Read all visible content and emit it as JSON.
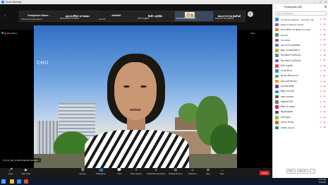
{
  "window": {
    "title": "Zoom Meeting"
  },
  "strip": {
    "tiles": [
      {
        "name": "Pornpimon Kaew...",
        "label": "Pornpimon Kaewsuwan"
      },
      {
        "name": "ผศ.ดร.ศิริพร ทรายทอง",
        "label": "ผศ.ดร.ศิริพร ทรายทอง"
      },
      {
        "name": "AdminK",
        "label": "adminK"
      },
      {
        "name": "ชิงช้า ครูนิจิต",
        "label": "ชิงช้า ครูนิจิต"
      },
      {
        "name": "",
        "label": "ก็มนาฟิลล์ โรงเรียนวัด..."
      },
      {
        "name": "คณะมาธารด สุขสันต์",
        "label": "คณะมาธารด สุขสันต์"
      }
    ]
  },
  "recording_label": "Recording...",
  "view_label": "View",
  "speaker": {
    "name_tag": "07-2_S6_S_S3 Pornpimon Songpo...",
    "backdrop_text": "CHU"
  },
  "toolbar": {
    "buttons": [
      {
        "icon": "microphone-icon",
        "glyph": "🎤",
        "label": "Audio"
      },
      {
        "icon": "video-icon",
        "glyph": "▶",
        "label": "Start Video"
      },
      {
        "icon": "security-icon",
        "glyph": "🛡",
        "label": "Security"
      },
      {
        "icon": "participants-icon",
        "glyph": "👥",
        "label": "Participants"
      },
      {
        "icon": "chat-icon",
        "glyph": "💬",
        "label": "Chat"
      },
      {
        "icon": "share-screen-icon",
        "glyph": "⬆",
        "label": "Share Screen"
      },
      {
        "icon": "record-icon",
        "glyph": "⏸",
        "label": "Pause/Stop Recording"
      },
      {
        "icon": "breakout-icon",
        "glyph": "⊞",
        "label": "Breakout Rooms"
      },
      {
        "icon": "reactions-icon",
        "glyph": "☺",
        "label": "Reactions"
      },
      {
        "icon": "apps-icon",
        "glyph": "⊕",
        "label": "Apps"
      },
      {
        "icon": "more-icon",
        "glyph": "…",
        "label": "More"
      }
    ],
    "leave_label": "Leave"
  },
  "panel": {
    "title": "Participants (38)",
    "search_placeholder": "Find a participant",
    "participants": [
      {
        "name": "Pornpimon Kaewsu... (Co-host, me)",
        "color": "#2d8cff"
      },
      {
        "name": "Sittiporn Siripoom (Host)",
        "color": "#7b5cd6"
      },
      {
        "name": "ผศ.ดร.ศิริพร ทรายทอง (Co-host)",
        "color": "#e27a2b"
      },
      {
        "name": "AdminK",
        "color": "#2aa876"
      },
      {
        "name": "Pornnittha",
        "color": "#c94b7e"
      },
      {
        "name": "คณะมาธารด สุขสันต์",
        "color": "#5a78d6"
      },
      {
        "name": "นิตยา ร่องทองไพศาล",
        "color": "#d6a22a"
      },
      {
        "name": "ก็มนาฟิลล์ โรงเรียนวัด",
        "color": "#3ba0a8"
      },
      {
        "name": "ก็มนาฟิลล์ โรงเรียนวัด",
        "color": "#8a5ad6"
      },
      {
        "name": "ชิงช้า ครูนิจิต",
        "color": "#e0524a"
      },
      {
        "name": "ประวิต ดีงาม",
        "color": "#2d8cff"
      },
      {
        "name": "สุดาพร เอี่ยมสะอาด",
        "color": "#4caf50"
      },
      {
        "name": "ชญานนท์ มิ่งขวัญ",
        "color": "#ff9800"
      },
      {
        "name": "วิมลรัตน์ ศรีสุข",
        "color": "#9c27b0"
      },
      {
        "name": "พิชญา แก้วมณี",
        "color": "#00acc1"
      },
      {
        "name": "ธนพร สายทอง",
        "color": "#795548"
      },
      {
        "name": "กิตติพงษ์ ใจดี",
        "color": "#607d8b"
      },
      {
        "name": "ศิริพร ทรายทอง",
        "color": "#e91e63"
      },
      {
        "name": "ณัฐวุฒิ พูลสุข",
        "color": "#3f51b5"
      },
      {
        "name": "อรุณี บุญมา",
        "color": "#8bc34a"
      },
      {
        "name": "สมชาย รักไทย",
        "color": "#ff5722"
      },
      {
        "name": "RUBB_Admin1",
        "color": "#009688"
      }
    ],
    "footer": {
      "invite": "Invite",
      "mute_all": "Mute All",
      "more": "..."
    }
  },
  "taskbar": {
    "time": "11:56 AM",
    "date": "9/4/2565"
  }
}
